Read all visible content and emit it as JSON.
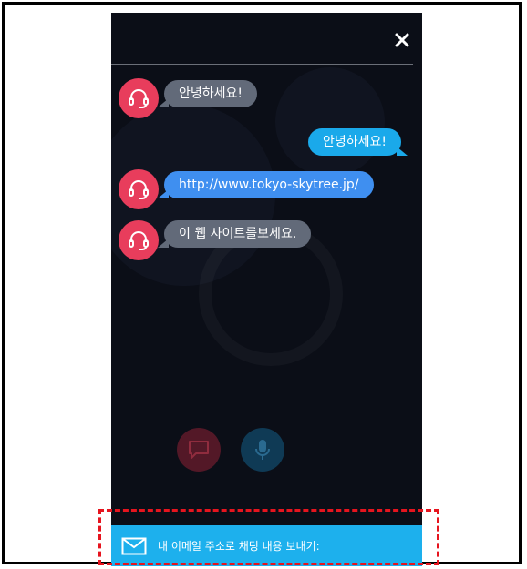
{
  "chat": {
    "messages": [
      {
        "sender": "agent",
        "text": "안녕하세요!"
      },
      {
        "sender": "user",
        "text": "안녕하세요!"
      },
      {
        "sender": "agent",
        "text": "http://www.tokyo-skytree.jp/"
      },
      {
        "sender": "agent",
        "text": "이 웹 사이트를보세요."
      }
    ]
  },
  "icons": {
    "close": "close-icon",
    "avatar": "headset-icon",
    "chat_button": "chat-icon",
    "mic_button": "microphone-icon",
    "email": "mail-icon"
  },
  "footer": {
    "email_label": "내 이메일 주소로 채팅 내용 보내기:"
  },
  "colors": {
    "background": "#0b0e17",
    "avatar": "#e83d5c",
    "agent_bubble": "#626a79",
    "link_bubble": "#3f8ff0",
    "user_bubble": "#1aa9ea",
    "email_bar": "#1db0ed",
    "highlight": "#e6141e"
  }
}
